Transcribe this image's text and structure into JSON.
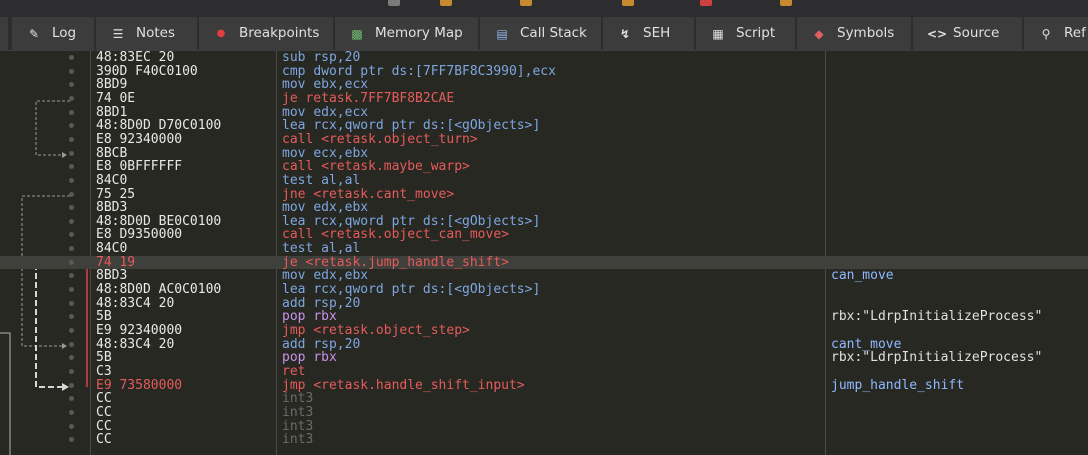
{
  "tabs": [
    {
      "label": "Log",
      "icon": "log-icon"
    },
    {
      "label": "Notes",
      "icon": "notes-icon"
    },
    {
      "label": "Breakpoints",
      "icon": "breakpoint-dot-icon"
    },
    {
      "label": "Memory Map",
      "icon": "memory-map-icon"
    },
    {
      "label": "Call Stack",
      "icon": "call-stack-icon"
    },
    {
      "label": "SEH",
      "icon": "seh-icon"
    },
    {
      "label": "Script",
      "icon": "script-icon"
    },
    {
      "label": "Symbols",
      "icon": "symbols-icon"
    },
    {
      "label": "Source",
      "icon": "source-icon"
    },
    {
      "label": "Ref",
      "icon": "references-icon"
    }
  ],
  "rows": [
    {
      "bytes": "48:83EC 20",
      "mnemonic": "sub",
      "operands": "rsp,20",
      "comment": ""
    },
    {
      "bytes": "390D F40C0100",
      "mnemonic": "cmp",
      "operands": "dword ptr ds:[7FF7BF8C3990],ecx",
      "comment": ""
    },
    {
      "bytes": "8BD9",
      "mnemonic": "mov",
      "operands": "ebx,ecx",
      "comment": ""
    },
    {
      "bytes": "74 0E",
      "mnemonic": "je",
      "operands": "retask.7FF7BF8B2CAE",
      "comment": ""
    },
    {
      "bytes": "8BD1",
      "mnemonic": "mov",
      "operands": "edx,ecx",
      "comment": ""
    },
    {
      "bytes": "48:8D0D D70C0100",
      "mnemonic": "lea",
      "operands": "rcx,qword ptr ds:[<gObjects>]",
      "comment": ""
    },
    {
      "bytes": "E8 92340000",
      "mnemonic": "call",
      "operands": "<retask.object_turn>",
      "comment": ""
    },
    {
      "bytes": "8BCB",
      "mnemonic": "mov",
      "operands": "ecx,ebx",
      "comment": ""
    },
    {
      "bytes": "E8 0BFFFFFF",
      "mnemonic": "call",
      "operands": "<retask.maybe_warp>",
      "comment": ""
    },
    {
      "bytes": "84C0",
      "mnemonic": "test",
      "operands": "al,al",
      "comment": ""
    },
    {
      "bytes": "75 25",
      "mnemonic": "jne",
      "operands": "<retask.cant_move>",
      "comment": ""
    },
    {
      "bytes": "8BD3",
      "mnemonic": "mov",
      "operands": "edx,ebx",
      "comment": ""
    },
    {
      "bytes": "48:8D0D BE0C0100",
      "mnemonic": "lea",
      "operands": "rcx,qword ptr ds:[<gObjects>]",
      "comment": ""
    },
    {
      "bytes": "E8 D9350000",
      "mnemonic": "call",
      "operands": "<retask.object_can_move>",
      "comment": ""
    },
    {
      "bytes": "84C0",
      "mnemonic": "test",
      "operands": "al,al",
      "comment": ""
    },
    {
      "bytes": "74 19",
      "mnemonic": "je",
      "operands": "<retask.jump_handle_shift>",
      "comment": ""
    },
    {
      "bytes": "8BD3",
      "mnemonic": "mov",
      "operands": "edx,ebx",
      "comment": "can_move"
    },
    {
      "bytes": "48:8D0D AC0C0100",
      "mnemonic": "lea",
      "operands": "rcx,qword ptr ds:[<gObjects>]",
      "comment": ""
    },
    {
      "bytes": "48:83C4 20",
      "mnemonic": "add",
      "operands": "rsp,20",
      "comment": ""
    },
    {
      "bytes": "5B",
      "mnemonic": "pop",
      "operands": "rbx",
      "comment": "rbx:\"LdrpInitializeProcess\""
    },
    {
      "bytes": "E9 92340000",
      "mnemonic": "jmp",
      "operands": "<retask.object_step>",
      "comment": ""
    },
    {
      "bytes": "48:83C4 20",
      "mnemonic": "add",
      "operands": "rsp,20",
      "comment": "cant_move"
    },
    {
      "bytes": "5B",
      "mnemonic": "pop",
      "operands": "rbx",
      "comment": "rbx:\"LdrpInitializeProcess\""
    },
    {
      "bytes": "C3",
      "mnemonic": "ret",
      "operands": "",
      "comment": ""
    },
    {
      "bytes": "E9 73580000",
      "mnemonic": "jmp",
      "operands": "<retask.handle_shift_input>",
      "comment": "jump_handle_shift"
    },
    {
      "bytes": "CC",
      "mnemonic": "int3",
      "operands": "",
      "comment": ""
    },
    {
      "bytes": "CC",
      "mnemonic": "int3",
      "operands": "",
      "comment": ""
    },
    {
      "bytes": "CC",
      "mnemonic": "int3",
      "operands": "",
      "comment": ""
    },
    {
      "bytes": "CC",
      "mnemonic": "int3",
      "operands": "",
      "comment": ""
    }
  ],
  "highlighted_row": 15,
  "branch_rows": [
    15,
    24
  ],
  "colors": {
    "background": "#272822",
    "highlight": "#3f3f3b",
    "call": "#e55b5b",
    "jump": "#e55b5b",
    "mov": "#7ea6e0",
    "push_pop": "#c792ea",
    "int3": "#6b6b6b",
    "branch_bytes": "#e55b5b"
  }
}
